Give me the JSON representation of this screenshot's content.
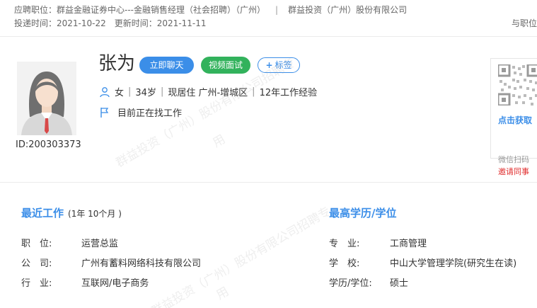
{
  "header": {
    "position_label": "应聘职位：",
    "position_value": "群益金融证券中心---金融销售经理（社会招聘）（广州）",
    "separator": "|",
    "company": "群益投资（广州）股份有限公司",
    "apply_time_label": "投递时间：",
    "apply_time": "2021-10-22",
    "update_time_label": "更新时间：",
    "update_time": "2021-11-11",
    "right_text": "与职位"
  },
  "profile": {
    "name": "张为",
    "candidate_id": "ID:200303373",
    "chat_button": "立即聊天",
    "video_button": "视频面试",
    "tag_button_plus": "+",
    "tag_button": "标签",
    "gender": "女",
    "age": "34岁",
    "location": "现居住 广州-增城区",
    "experience": "12年工作经验",
    "job_status": "目前正在找工作"
  },
  "qr": {
    "fetch_text": "点击获取",
    "wechat_text": "微信扫码",
    "invite_text": "邀请同事"
  },
  "work": {
    "title": "最近工作",
    "duration": "(1年 10个月 )",
    "fields": [
      {
        "label": "职　位:",
        "value": "运营总监"
      },
      {
        "label": "公　司:",
        "value": "广州有蓄料网络科技有限公司"
      },
      {
        "label": "行　业:",
        "value": "互联网/电子商务"
      }
    ]
  },
  "education": {
    "title": "最高学历/学位",
    "fields": [
      {
        "label": "专　业:",
        "value": "工商管理"
      },
      {
        "label": "学　校:",
        "value": "中山大学管理学院(研究生在读)"
      },
      {
        "label": "学历/学位:",
        "value": "硕士"
      }
    ]
  },
  "watermark": {
    "line1": "群益投资（广州）股份有限公司招聘专",
    "line2": "用"
  },
  "colors": {
    "accent": "#3b8ee8",
    "video_green": "#32b25c",
    "invite_red": "#e02e2e"
  }
}
